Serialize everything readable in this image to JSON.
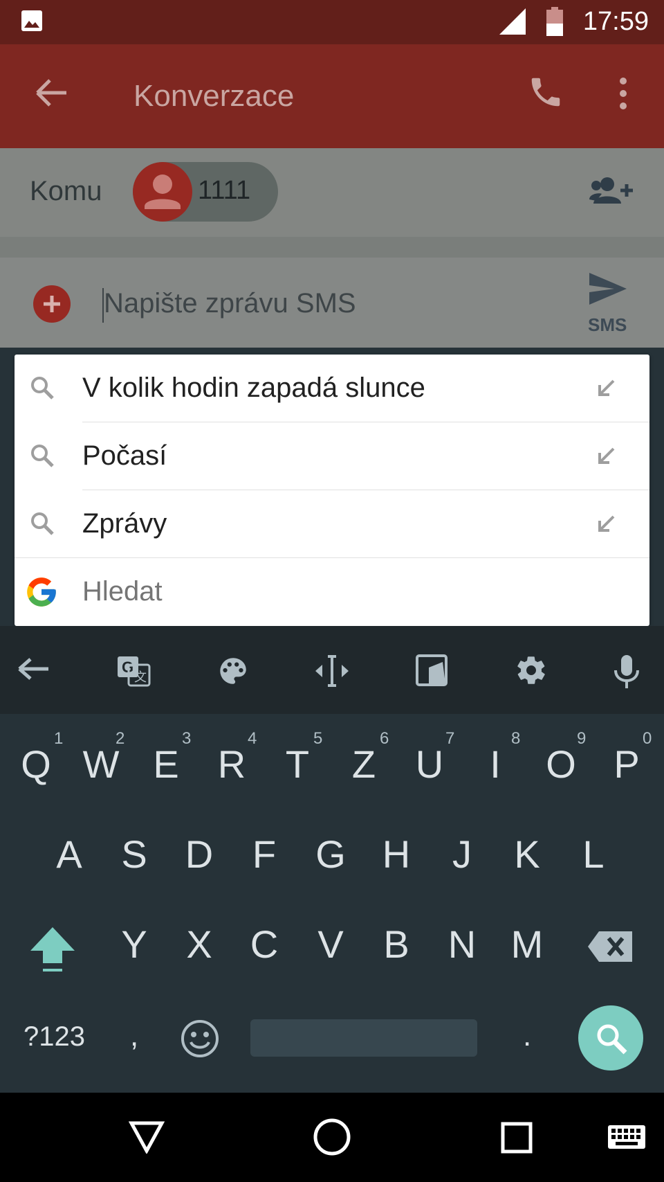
{
  "status_bar": {
    "time": "17:59",
    "icons": [
      "image-notification-icon",
      "signal-icon",
      "battery-icon"
    ]
  },
  "app_bar": {
    "title": "Konverzace",
    "icons": [
      "back-arrow-icon",
      "phone-icon",
      "overflow-menu-icon"
    ]
  },
  "recipient": {
    "label": "Komu",
    "chip_number": "1111",
    "add_contact_icon": "add-contact-icon"
  },
  "compose": {
    "placeholder": "Napište zprávu SMS",
    "send_label": "SMS"
  },
  "suggestions": {
    "items": [
      {
        "text": "V kolik hodin zapadá slunce"
      },
      {
        "text": "Počasí"
      },
      {
        "text": "Zprávy"
      }
    ],
    "google_placeholder": "Hledat"
  },
  "keyboard_toolbar": {
    "icons": [
      "back-arrow-icon",
      "translate-icon",
      "palette-icon",
      "text-cursor-icon",
      "one-handed-icon",
      "settings-icon",
      "microphone-icon"
    ]
  },
  "keyboard": {
    "row1": [
      "Q",
      "W",
      "E",
      "R",
      "T",
      "Z",
      "U",
      "I",
      "O",
      "P"
    ],
    "row1_hints": [
      "1",
      "2",
      "3",
      "4",
      "5",
      "6",
      "7",
      "8",
      "9",
      "0"
    ],
    "row2": [
      "A",
      "S",
      "D",
      "F",
      "G",
      "H",
      "J",
      "K",
      "L"
    ],
    "row3": [
      "Y",
      "X",
      "C",
      "V",
      "B",
      "N",
      "M"
    ],
    "symbols_label": "?123",
    "comma": ",",
    "period": ".",
    "accent_color": "#7dcdc1"
  },
  "nav_bar": {
    "icons": [
      "back-triangle-icon",
      "home-circle-icon",
      "recents-square-icon",
      "keyboard-icon"
    ]
  }
}
